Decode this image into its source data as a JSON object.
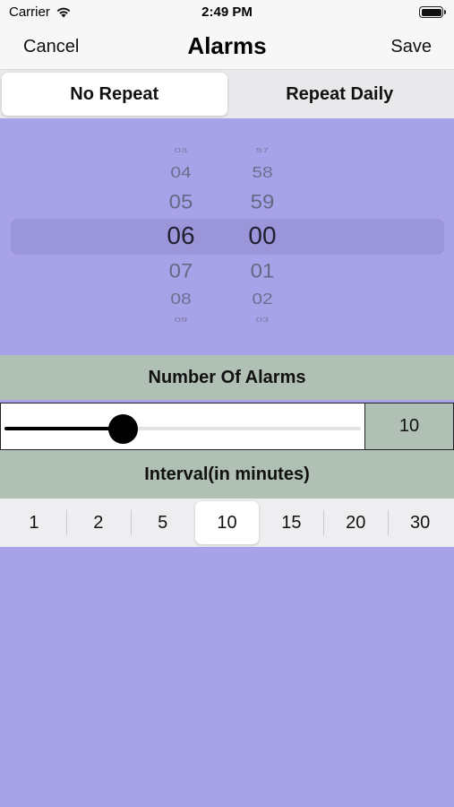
{
  "status_bar": {
    "carrier": "Carrier",
    "time": "2:49 PM"
  },
  "nav": {
    "cancel": "Cancel",
    "title": "Alarms",
    "save": "Save"
  },
  "repeat": {
    "options": [
      "No Repeat",
      "Repeat Daily"
    ],
    "selected": "No Repeat"
  },
  "picker": {
    "hours": [
      "03",
      "04",
      "05",
      "06",
      "07",
      "08",
      "09"
    ],
    "minutes": [
      "57",
      "58",
      "59",
      "00",
      "01",
      "02",
      "03"
    ],
    "selected_hour": "06",
    "selected_minute": "00"
  },
  "number_of_alarms": {
    "label": "Number Of Alarms",
    "value": "10",
    "slider_fraction": 0.33
  },
  "interval": {
    "label": "Interval(in minutes)",
    "options": [
      "1",
      "2",
      "5",
      "10",
      "15",
      "20",
      "30"
    ],
    "selected": "10"
  },
  "colors": {
    "background": "#a8a2e8",
    "band": "#b0c0b5",
    "segment_bg": "#e9e9eb"
  },
  "icons": {
    "wifi": "wifi-icon",
    "battery": "battery-icon"
  }
}
